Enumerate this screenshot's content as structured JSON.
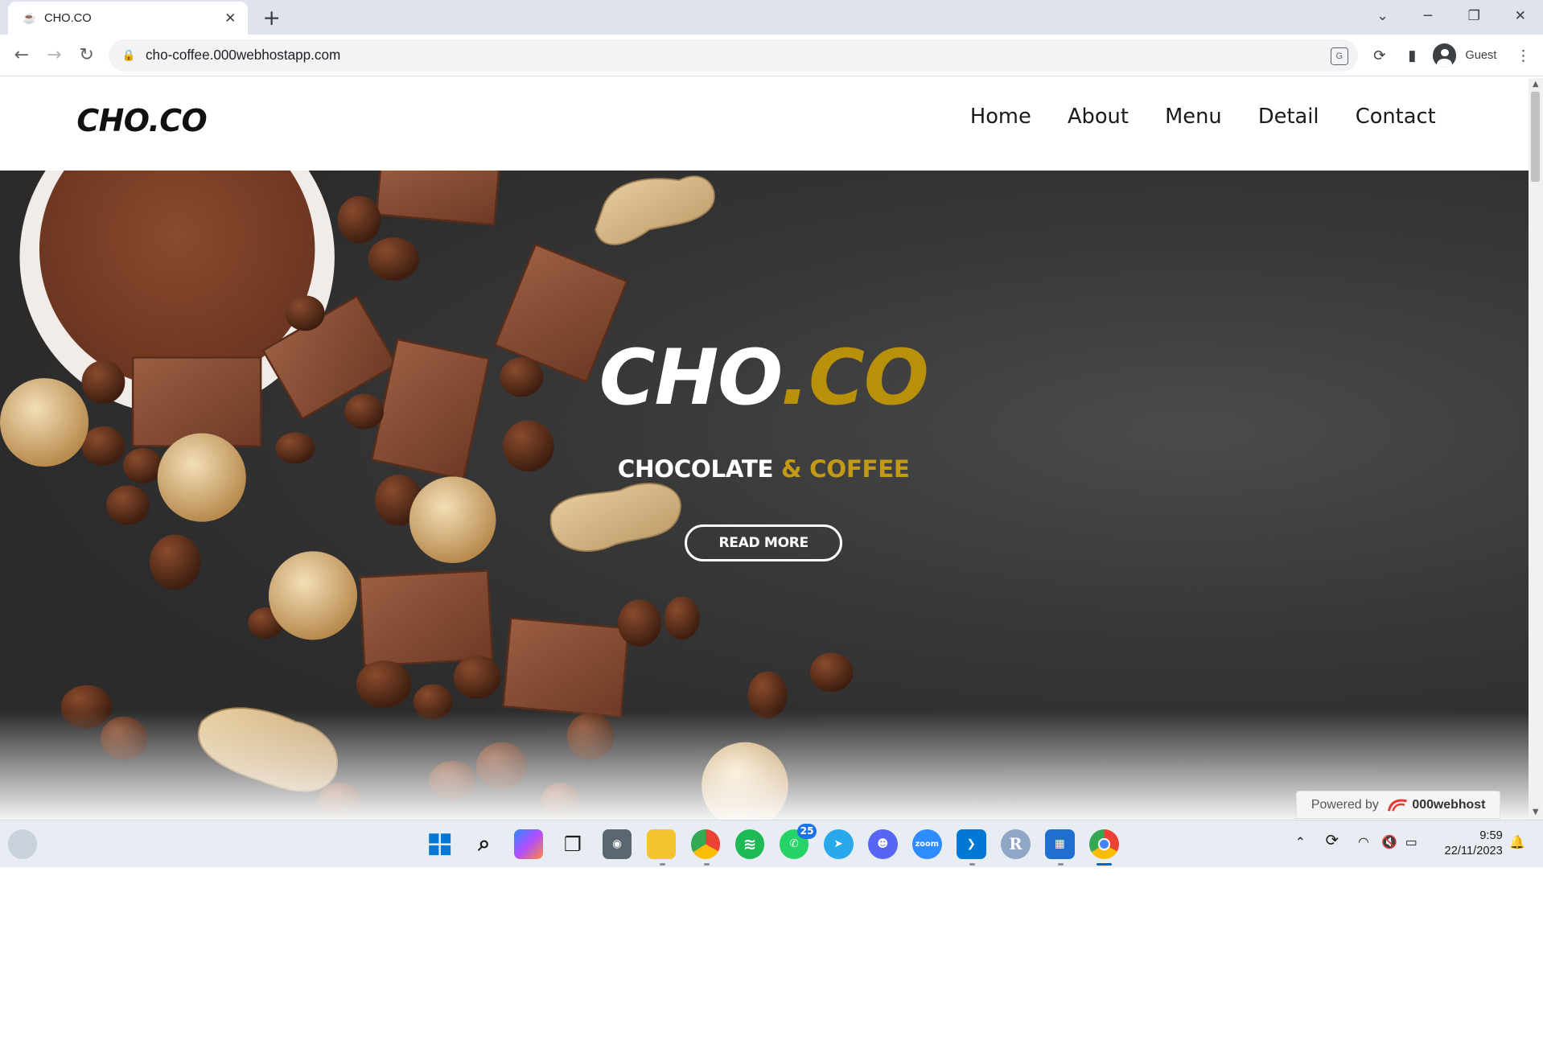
{
  "browser": {
    "tab_title": "CHO.CO",
    "url": "cho-coffee.000webhostapp.com",
    "profile_label": "Guest"
  },
  "site": {
    "logo": "CHO.CO",
    "nav": [
      "Home",
      "About",
      "Menu",
      "Detail",
      "Contact"
    ],
    "hero": {
      "title_white": "CHO",
      "title_gold": ".CO",
      "subtitle_white": "CHOCOLATE",
      "subtitle_gold": "& COFFEE",
      "button": "READ MORE"
    },
    "powered_by": "Powered by",
    "host_brand": "000webhost"
  },
  "taskbar": {
    "whatsapp_badge": "25",
    "zoom_label": "zoom",
    "r_label": "R",
    "time": "9:59",
    "date": "22/11/2023"
  },
  "colors": {
    "accent_gold": "#b8900a",
    "hero_background": "#2f2f2f",
    "chrome_tabbar": "#dfe3eb"
  }
}
